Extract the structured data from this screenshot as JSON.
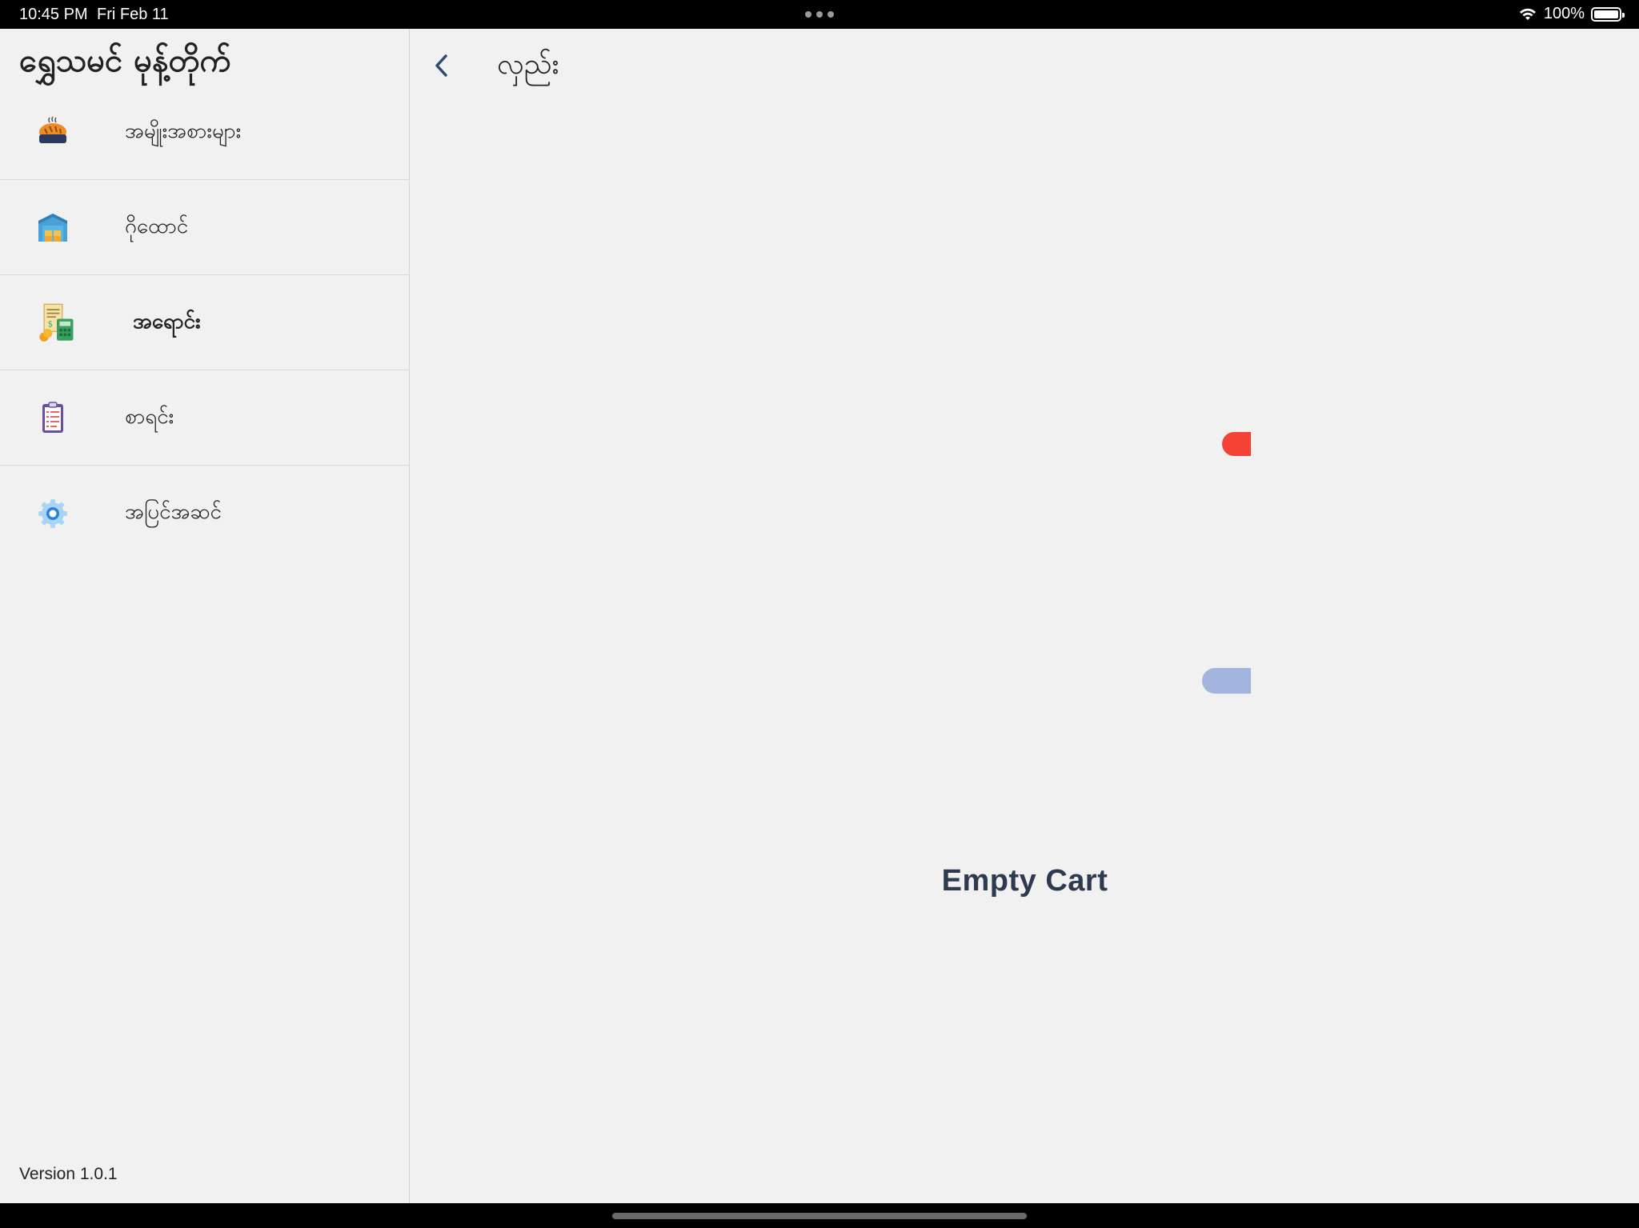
{
  "status_bar": {
    "time": "10:45 PM",
    "date": "Fri Feb 11",
    "battery": "100%"
  },
  "sidebar": {
    "title": "ရွှေသမင် မုန့်တိုက်",
    "items": [
      {
        "label": "အမျိုးအစားများ",
        "icon": "bread-icon"
      },
      {
        "label": "ဂိုထောင်",
        "icon": "warehouse-icon"
      },
      {
        "label": "အရောင်း",
        "icon": "sales-calculator-icon",
        "active": true
      },
      {
        "label": "စာရင်း",
        "icon": "clipboard-icon"
      },
      {
        "label": "အပြင်အဆင်",
        "icon": "settings-gear-icon"
      }
    ],
    "version": "Version 1.0.1"
  },
  "header": {
    "title": "လှည်း"
  },
  "main": {
    "empty_message": "Empty Cart"
  },
  "colors": {
    "cart_body": "#b4cdf9",
    "cart_shadow": "#a3b5de",
    "cart_handle": "#f44336",
    "wheel": "#2f4f8a",
    "text_dark": "#2d3a4f"
  }
}
